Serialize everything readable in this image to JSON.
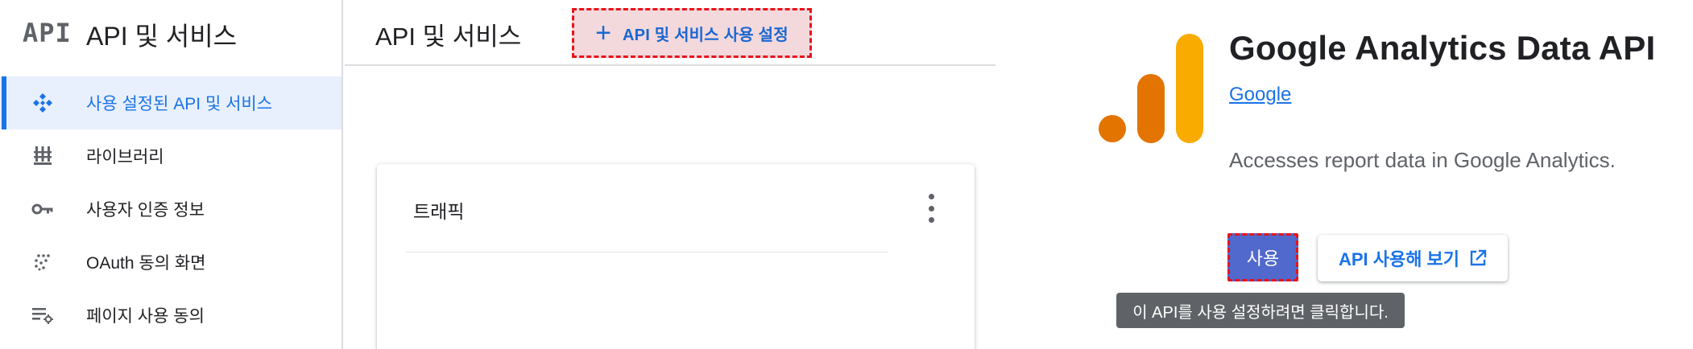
{
  "console": {
    "logo": "API",
    "sidebar_title": "API 및 서비스",
    "nav": [
      {
        "label": "사용 설정된 API 및 서비스",
        "icon": "enabled-apis-icon"
      },
      {
        "label": "라이브러리",
        "icon": "library-icon"
      },
      {
        "label": "사용자 인증 정보",
        "icon": "key-icon"
      },
      {
        "label": "OAuth 동의 화면",
        "icon": "oauth-dots-icon"
      },
      {
        "label": "페이지 사용 동의",
        "icon": "settings-list-icon"
      }
    ],
    "page_title": "API 및 서비스",
    "enable_apis_button": {
      "icon": "plus-icon",
      "label": "API 및 서비스 사용 설정"
    },
    "traffic_card": {
      "title": "트래픽",
      "menu_icon": "more-vert-icon"
    }
  },
  "detail": {
    "logo_icon": "google-analytics-logo",
    "title": "Google Analytics Data API",
    "provider": "Google",
    "description": "Accesses report data in Google Analytics.",
    "enable_button": "사용",
    "try_button": {
      "label": "API 사용해 보기",
      "icon": "open-in-new-icon"
    },
    "tooltip": "이 API를 사용 설정하려면 클릭합니다."
  },
  "colors": {
    "accent": "#1a73e8",
    "enable_button_bg": "#5168cc",
    "highlight_border": "#e8131a",
    "ga_orange_light": "#f9ab00",
    "ga_orange_dark": "#e37400"
  }
}
